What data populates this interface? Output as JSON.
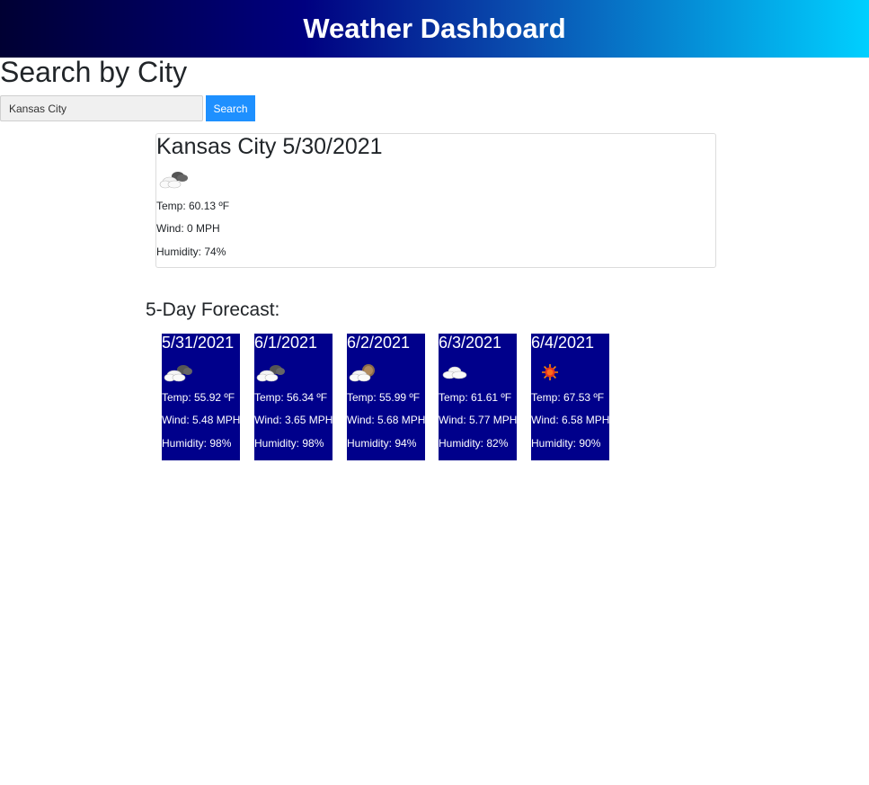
{
  "header": {
    "title": "Weather Dashboard"
  },
  "search": {
    "heading": "Search by City",
    "input_value": "Kansas City",
    "button_label": "Search"
  },
  "current": {
    "city": "Kansas City",
    "date": "5/30/2021",
    "icon": "broken-clouds-icon",
    "temp": "Temp: 60.13 ºF",
    "wind": "Wind: 0 MPH",
    "humidity": "Humidity: 74%"
  },
  "forecast": {
    "heading": "5-Day Forecast:",
    "days": [
      {
        "date": "5/31/2021",
        "icon": "broken-clouds-icon",
        "temp": "Temp: 55.92 ºF",
        "wind": "Wind: 5.48 MPH",
        "humidity": "Humidity: 98%"
      },
      {
        "date": "6/1/2021",
        "icon": "broken-clouds-icon",
        "temp": "Temp: 56.34 ºF",
        "wind": "Wind: 3.65 MPH",
        "humidity": "Humidity: 98%"
      },
      {
        "date": "6/2/2021",
        "icon": "partly-cloudy-icon",
        "temp": "Temp: 55.99 ºF",
        "wind": "Wind: 5.68 MPH",
        "humidity": "Humidity: 94%"
      },
      {
        "date": "6/3/2021",
        "icon": "cloud-icon",
        "temp": "Temp: 61.61 ºF",
        "wind": "Wind: 5.77 MPH",
        "humidity": "Humidity: 82%"
      },
      {
        "date": "6/4/2021",
        "icon": "sun-icon",
        "temp": "Temp: 67.53 ºF",
        "wind": "Wind: 6.58 MPH",
        "humidity": "Humidity: 90%"
      }
    ]
  },
  "colors": {
    "header_start": "#000033",
    "header_end": "#00d0ff",
    "button": "#1e90ff",
    "forecast_card": "#00008b"
  }
}
